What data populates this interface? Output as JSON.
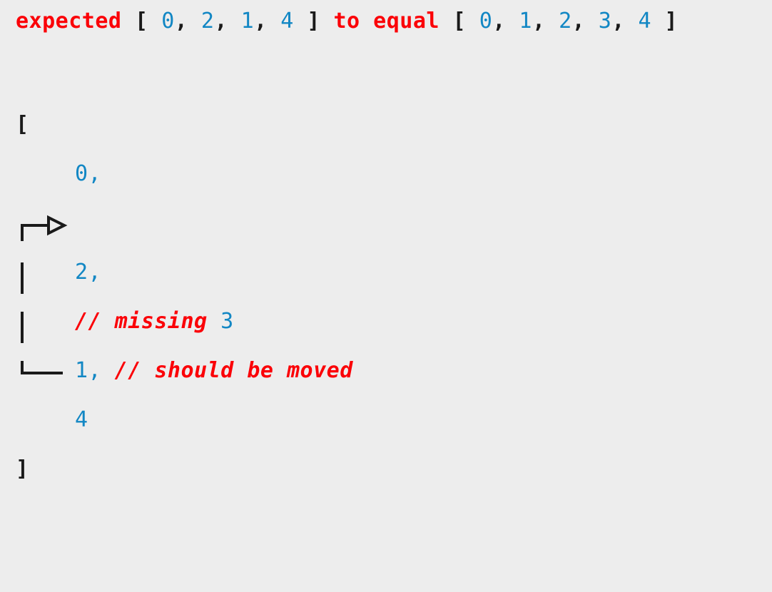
{
  "theme": {
    "background": "#ededed",
    "keyword_color": "#fb0007",
    "number_color": "#1287c4",
    "punctuation_color": "#1a1a1a",
    "connector_color": "#1a1a1a"
  },
  "assertion": {
    "expected_label": "expected",
    "actual_open": " [ ",
    "actual_values": [
      "0",
      "2",
      "1",
      "4"
    ],
    "separator": ", ",
    "actual_close": " ] ",
    "to_equal_label": "to equal",
    "expected_open": " [ ",
    "expected_values": [
      "0",
      "1",
      "2",
      "3",
      "4"
    ],
    "expected_close": " ]",
    "full_text": "expected [ 0, 2, 1, 4 ] to equal [ 0, 1, 2, 3, 4 ]"
  },
  "diff": {
    "open_bracket": "[",
    "close_bracket": "]",
    "lines": [
      {
        "id": "line-open",
        "gutter": "[",
        "value": "",
        "comment": ""
      },
      {
        "id": "line-zero",
        "gutter": "",
        "value": "0,",
        "comment": ""
      },
      {
        "id": "line-arrow",
        "gutter": "",
        "value": "",
        "comment": ""
      },
      {
        "id": "line-two",
        "gutter": "",
        "value": "2,",
        "comment": ""
      },
      {
        "id": "line-missing",
        "gutter": "",
        "value": "",
        "comment": "// missing",
        "trailing_number": "3"
      },
      {
        "id": "line-one",
        "gutter": "",
        "value": "1,",
        "comment": "// should be moved"
      },
      {
        "id": "line-four",
        "gutter": "",
        "value": "4",
        "comment": ""
      },
      {
        "id": "line-close",
        "gutter": "]",
        "value": "",
        "comment": ""
      }
    ]
  },
  "annotations": {
    "move_arrow_label": "move-marker-arrow",
    "missing_comment": "// missing",
    "missing_number": "3",
    "moved_comment": "// should be moved"
  }
}
